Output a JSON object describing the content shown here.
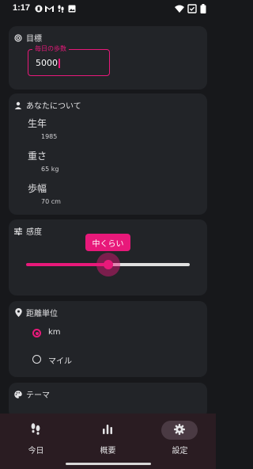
{
  "status_bar": {
    "time": "1:17",
    "battery_icon": "battery-icon",
    "wifi_icon": "wifi-icon"
  },
  "goal": {
    "title": "目標",
    "icon": "target-icon",
    "field_label": "毎日の歩数",
    "field_value": "5000"
  },
  "about": {
    "title": "あなたについて",
    "icon": "person-icon",
    "items": [
      {
        "label": "生年",
        "value": "1985"
      },
      {
        "label": "重さ",
        "value": "65 kg"
      },
      {
        "label": "歩幅",
        "value": "70 cm"
      }
    ]
  },
  "sensitivity": {
    "title": "感度",
    "icon": "tune-icon",
    "tooltip": "中くらい",
    "level": 0.5
  },
  "distance_unit": {
    "title": "距離単位",
    "icon": "location-pin-icon",
    "options": [
      {
        "label": "km",
        "selected": true
      },
      {
        "label": "マイル",
        "selected": false
      }
    ]
  },
  "theme": {
    "title": "テーマ",
    "icon": "palette-icon"
  },
  "nav": {
    "items": [
      {
        "label": "今日",
        "icon": "footsteps-icon",
        "active": false
      },
      {
        "label": "概要",
        "icon": "bar-chart-icon",
        "active": false
      },
      {
        "label": "設定",
        "icon": "gear-icon",
        "active": true
      }
    ]
  },
  "colors": {
    "accent": "#e8197a",
    "background": "#17181b",
    "card": "#222428",
    "navbar": "#2a1c22"
  }
}
